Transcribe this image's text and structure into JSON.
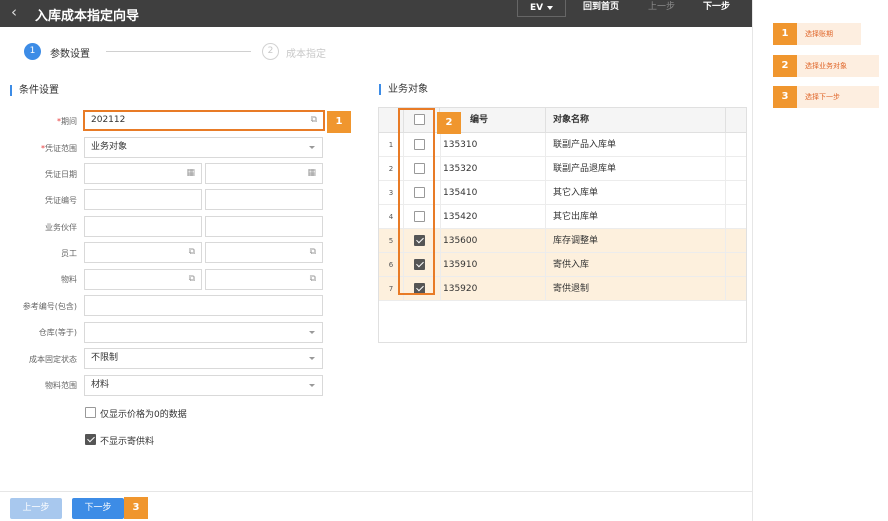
{
  "header": {
    "back_icon": "chevron-left-icon",
    "title": "入库成本指定向导",
    "ev_label": "EV",
    "home_label": "回到首页",
    "prev_label": "上一步",
    "next_label": "下一步"
  },
  "steps": [
    {
      "number": "1",
      "label": "参数设置",
      "active": true
    },
    {
      "number": "2",
      "label": "成本指定",
      "active": false
    }
  ],
  "conditions": {
    "section_title": "条件设置",
    "period_label": "期间",
    "period_value": "202112",
    "voucher_scope_label": "凭证范围",
    "voucher_scope_value": "业务对象",
    "voucher_date_label": "凭证日期",
    "voucher_no_label": "凭证编号",
    "partner_label": "业务伙伴",
    "employee_label": "员工",
    "material_label": "物料",
    "ref_no_label": "参考编号(包含)",
    "warehouse_label": "仓库(等于)",
    "cost_fixed_label": "成本固定状态",
    "cost_fixed_value": "不限制",
    "material_scope_label": "物料范围",
    "material_scope_value": "材料",
    "only_zero_price_label": "仅显示价格为0的数据",
    "only_zero_price_checked": false,
    "hide_consigned_label": "不显示寄供料",
    "hide_consigned_checked": true
  },
  "business_objects": {
    "section_title": "业务对象",
    "col_code": "编号",
    "col_name": "对象名称",
    "rows": [
      {
        "idx": "1",
        "code": "135310",
        "name": "联副产品入库单",
        "checked": false
      },
      {
        "idx": "2",
        "code": "135320",
        "name": "联副产品退库单",
        "checked": false
      },
      {
        "idx": "3",
        "code": "135410",
        "name": "其它入库单",
        "checked": false
      },
      {
        "idx": "4",
        "code": "135420",
        "name": "其它出库单",
        "checked": false
      },
      {
        "idx": "5",
        "code": "135600",
        "name": "库存调整单",
        "checked": true
      },
      {
        "idx": "6",
        "code": "135910",
        "name": "寄供入库",
        "checked": true
      },
      {
        "idx": "7",
        "code": "135920",
        "name": "寄供退制",
        "checked": true
      }
    ]
  },
  "callouts": {
    "one": "1",
    "two": "2",
    "three": "3"
  },
  "footer": {
    "prev_label": "上一步",
    "next_label": "下一步"
  },
  "help": [
    {
      "number": "1",
      "text": "选择账期"
    },
    {
      "number": "2",
      "text": "选择业务对象"
    },
    {
      "number": "3",
      "text": "选择下一步"
    }
  ],
  "colors": {
    "accent": "#3d8ce6",
    "highlight": "#e87b26",
    "badge": "#f0962e",
    "selected_row": "#fdf0dd"
  }
}
